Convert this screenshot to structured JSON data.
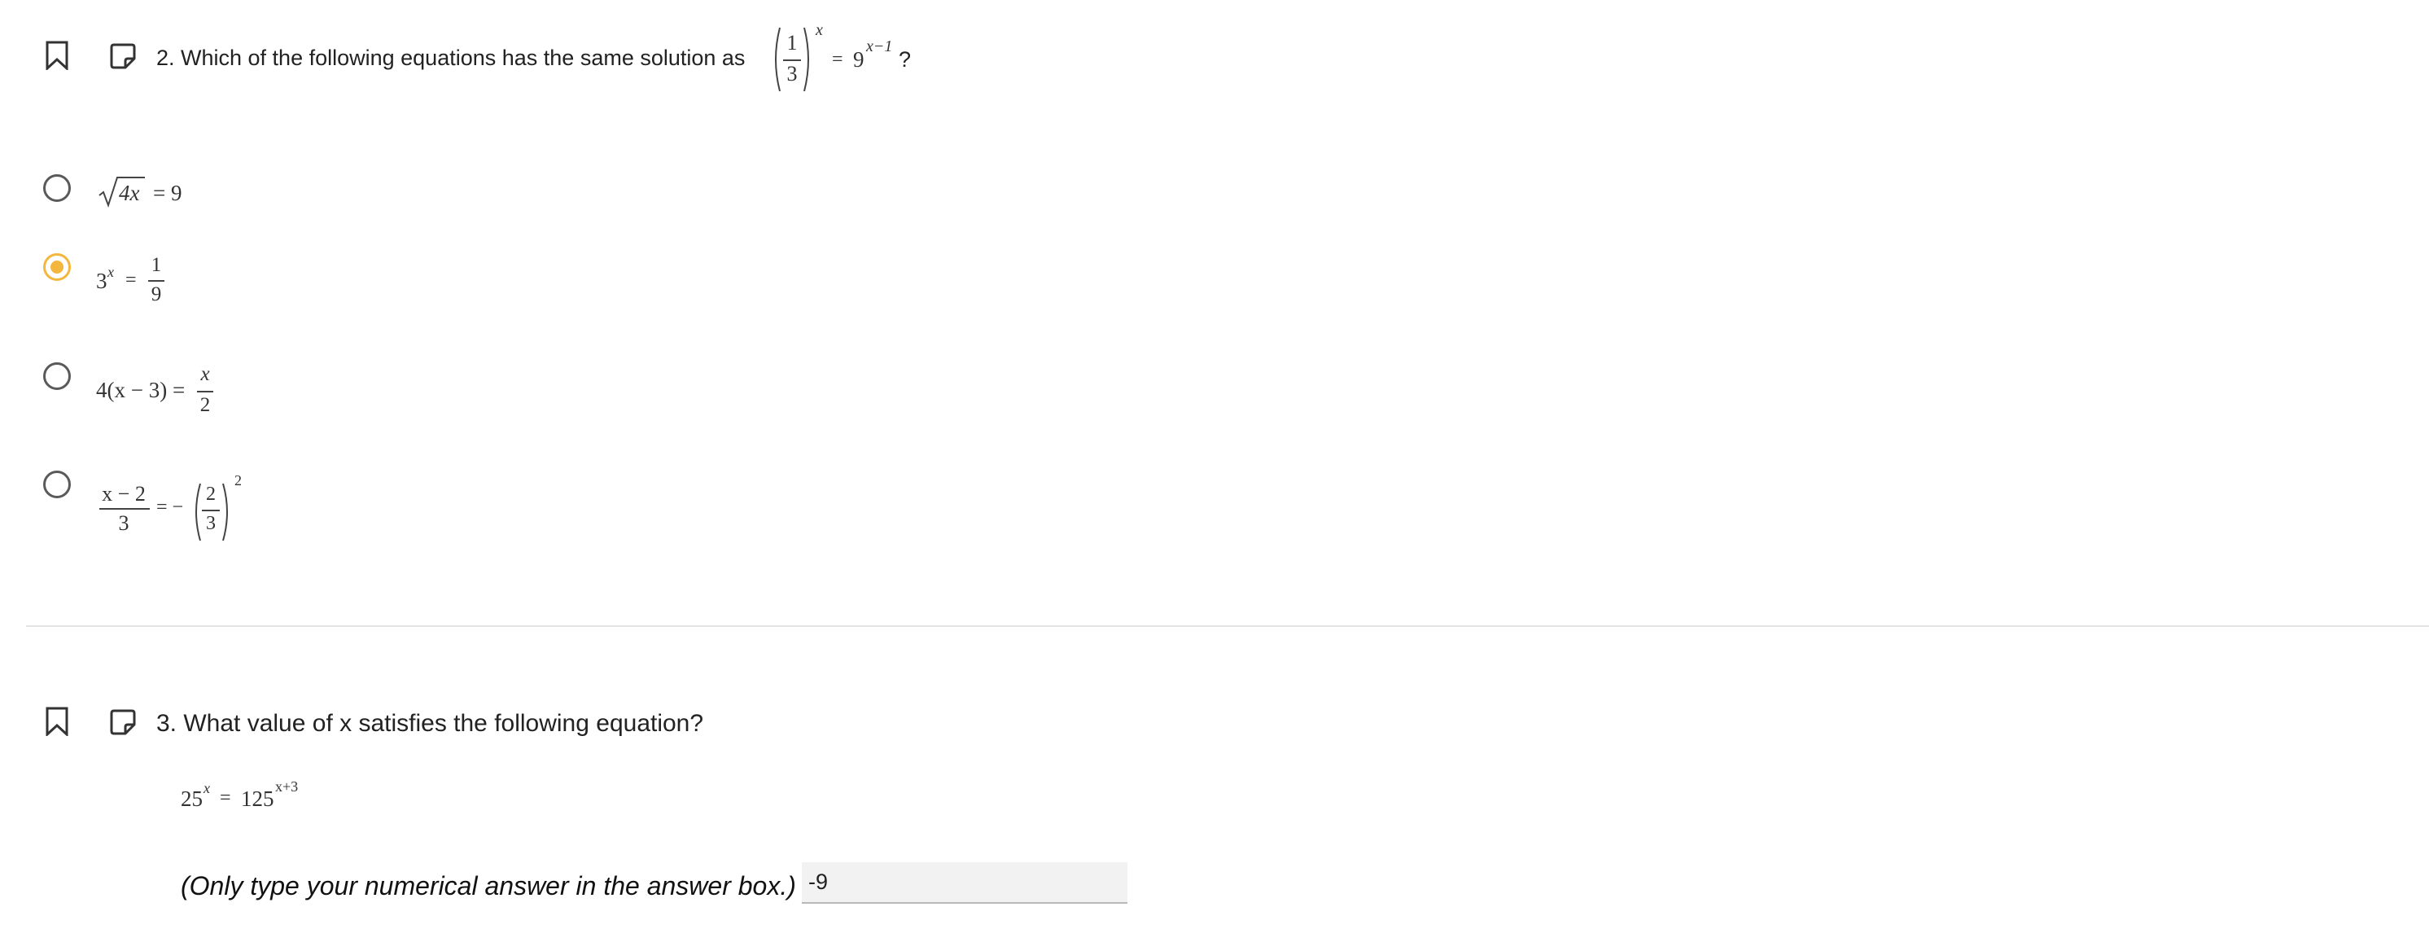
{
  "q2": {
    "text": "2. Which of the following equations has the same solution as",
    "lhs_num": "1",
    "lhs_den": "3",
    "lhs_exp": "x",
    "eq": "=",
    "rhs_base": "9",
    "rhs_exp": "x−1",
    "tail": "?",
    "options": [
      {
        "radical": "4x",
        "rest": "= 9",
        "selected": false
      },
      {
        "base": "3",
        "exp": "x",
        "eq": "=",
        "num": "1",
        "den": "9",
        "selected": true
      },
      {
        "lhs": "4(x − 3) =",
        "num": "x",
        "den": "2",
        "selected": false
      },
      {
        "num": "x − 2",
        "den": "3",
        "mid": "= −",
        "inner_num": "2",
        "inner_den": "3",
        "exp": "2",
        "selected": false
      }
    ]
  },
  "q3": {
    "text": "3. What value of x satisfies the following equation?",
    "lhs_base": "25",
    "lhs_exp": "x",
    "eq": "=",
    "rhs_base": "125",
    "rhs_exp": "x+3",
    "instruction": "(Only type your numerical answer in the answer box.)",
    "answer_value": "-9"
  },
  "colors": {
    "radio_selected": "#f4b73e",
    "radio_default": "#5a5a5a",
    "divider": "#e3e3e3",
    "answer_bg": "#f2f2f2"
  },
  "icons": {
    "bookmark": "bookmark-icon",
    "note": "note-icon"
  }
}
